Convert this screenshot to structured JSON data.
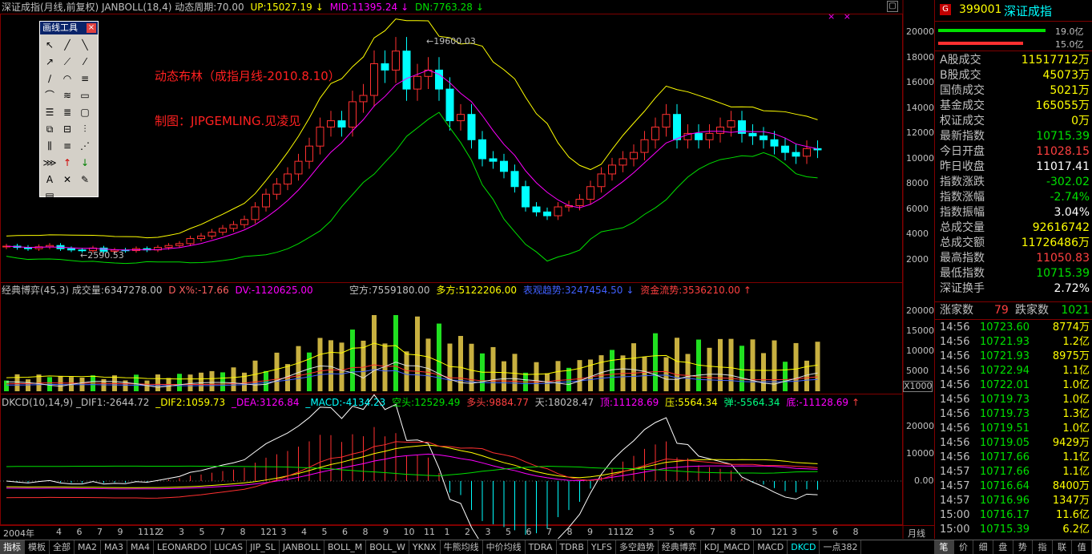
{
  "main_header": {
    "title": "深证成指(月线,前复权) JANBOLL(18,4) 动态周期:70.00",
    "up": "UP:15027.19",
    "mid": "MID:11395.24",
    "dn": "DN:7763.28"
  },
  "annotations": {
    "line1": "动态布林（成指月线-2010.8.10）",
    "line2": "制图：JIPGEMLING.见凌见",
    "high_label": "19600.03",
    "low_label": "2590.53"
  },
  "main_axis": [
    "20000",
    "18000",
    "16000",
    "14000",
    "12000",
    "10000",
    "8000",
    "6000",
    "4000",
    "2000"
  ],
  "vol_header": {
    "name": "经典博弈(45,3) 成交量:6347278.00",
    "dx": "D X%:-17.66",
    "dv": "DV:-1120625.00",
    "kong": "空方:7559180.00",
    "duo": "多方:5122206.00",
    "biao": "表观趋势:3247454.50",
    "zijin": "资金流势:3536210.00"
  },
  "vol_axis": [
    "20000",
    "15000",
    "10000",
    "5000"
  ],
  "vol_unit": "X1000",
  "dkcd_header": {
    "name": "DKCD(10,14,9) _DIF1:-2644.72",
    "dif2": "_DIF2:1059.73",
    "dea": "_DEA:3126.84",
    "macd": "_MACD:-4134.23",
    "kongtou": "空头:12529.49",
    "duotou": "多头:9884.77",
    "tian": "天:18028.47",
    "ding": "顶:11128.69",
    "ya": "压:5564.34",
    "tan": "弹:-5564.34",
    "di": "底:-11128.69"
  },
  "dkcd_axis": [
    "20000",
    "10000",
    "0.00"
  ],
  "time_axis": {
    "start": "2004年",
    "labels": [
      "4",
      "6",
      "7",
      "9",
      "1112",
      "2",
      "3",
      "5",
      "7",
      "8",
      "121",
      "3",
      "4",
      "5",
      "6",
      "8",
      "9",
      "10",
      "11",
      "1",
      "2",
      "3",
      "5",
      "6",
      "7",
      "8",
      "9",
      "1112",
      "2",
      "3",
      "5",
      "6",
      "7",
      "8",
      "10",
      "121",
      "3",
      "5",
      "6",
      "8"
    ],
    "period": "月线"
  },
  "right_panel": {
    "code": "399001",
    "name": "深证成指",
    "bar1": "19.0亿",
    "bar2": "15.0亿",
    "rows": [
      {
        "label": "A股成交",
        "value": "11517712万",
        "color": "#ffff00"
      },
      {
        "label": "B股成交",
        "value": "45073万",
        "color": "#ffff00"
      },
      {
        "label": "国债成交",
        "value": "5021万",
        "color": "#ffff00"
      },
      {
        "label": "基金成交",
        "value": "165055万",
        "color": "#ffff00"
      },
      {
        "label": "权证成交",
        "value": "0万",
        "color": "#ffff00"
      },
      {
        "label": "最新指数",
        "value": "10715.39",
        "color": "#00e000"
      },
      {
        "label": "今日开盘",
        "value": "11028.15",
        "color": "#ff4040"
      },
      {
        "label": "昨日收盘",
        "value": "11017.41",
        "color": "#ffffff"
      },
      {
        "label": "指数涨跌",
        "value": "-302.02",
        "color": "#00e000"
      },
      {
        "label": "指数涨幅",
        "value": "-2.74%",
        "color": "#00e000"
      },
      {
        "label": "指数振幅",
        "value": "3.04%",
        "color": "#ffffff"
      },
      {
        "label": "总成交量",
        "value": "92616742",
        "color": "#ffff00"
      },
      {
        "label": "总成交额",
        "value": "11726486万",
        "color": "#ffff00"
      },
      {
        "label": "最高指数",
        "value": "11050.83",
        "color": "#ff4040"
      },
      {
        "label": "最低指数",
        "value": "10715.39",
        "color": "#00e000"
      },
      {
        "label": "深证换手",
        "value": "2.72%",
        "color": "#ffffff"
      }
    ],
    "updown": {
      "up_label": "涨家数",
      "up": "79",
      "down_label": "跌家数",
      "down": "1021"
    },
    "ticks": [
      {
        "t": "14:56",
        "p": "10723.60",
        "v": "8774万"
      },
      {
        "t": "14:56",
        "p": "10721.93",
        "v": "1.2亿"
      },
      {
        "t": "14:56",
        "p": "10721.93",
        "v": "8975万"
      },
      {
        "t": "14:56",
        "p": "10722.94",
        "v": "1.1亿"
      },
      {
        "t": "14:56",
        "p": "10722.01",
        "v": "1.0亿"
      },
      {
        "t": "14:56",
        "p": "10719.73",
        "v": "1.0亿"
      },
      {
        "t": "14:56",
        "p": "10719.73",
        "v": "1.3亿"
      },
      {
        "t": "14:56",
        "p": "10719.51",
        "v": "1.0亿"
      },
      {
        "t": "14:56",
        "p": "10719.05",
        "v": "9429万"
      },
      {
        "t": "14:56",
        "p": "10717.66",
        "v": "1.1亿"
      },
      {
        "t": "14:57",
        "p": "10717.66",
        "v": "1.1亿"
      },
      {
        "t": "14:57",
        "p": "10716.64",
        "v": "8400万"
      },
      {
        "t": "14:57",
        "p": "10716.96",
        "v": "1347万"
      },
      {
        "t": "15:00",
        "p": "10716.17",
        "v": "11.6亿"
      },
      {
        "t": "15:00",
        "p": "10715.39",
        "v": "6.2亿"
      }
    ],
    "bottom_tabs": [
      "笔",
      "价",
      "细",
      "盘",
      "势",
      "指",
      "联",
      "值"
    ]
  },
  "toolbox": {
    "title": "画线工具"
  },
  "bottom_tabs": [
    "指标",
    "模板",
    "全部",
    "MA2",
    "MA3",
    "MA4",
    "LEONARDO",
    "LUCAS",
    "JIP_SL",
    "JANBOLL",
    "BOLL_M",
    "BOLL_W",
    "YKNX",
    "牛熊均线",
    "中价均线",
    "TDRA",
    "TDRB",
    "YLFS",
    "多空趋势",
    "经典博弈",
    "KDJ_MACD",
    "MACD",
    "DKCD",
    "一点382"
  ],
  "chart_data": {
    "type": "candlestick",
    "series": [
      {
        "name": "UP",
        "values": [
          4100,
          4050,
          4000,
          3950,
          4000,
          4200,
          4800,
          6000,
          9000,
          14000,
          18000,
          20500,
          20300,
          19500,
          18500,
          17000,
          15500,
          14500,
          14000,
          14500,
          15000,
          14800,
          14600,
          14300,
          14000,
          14200,
          14500,
          14200,
          14000,
          13500,
          13200,
          13000,
          12800,
          12700,
          12600,
          12400,
          12300,
          12200,
          12100,
          12000,
          11900,
          11850,
          11800,
          11700
        ]
      }
    ]
  }
}
